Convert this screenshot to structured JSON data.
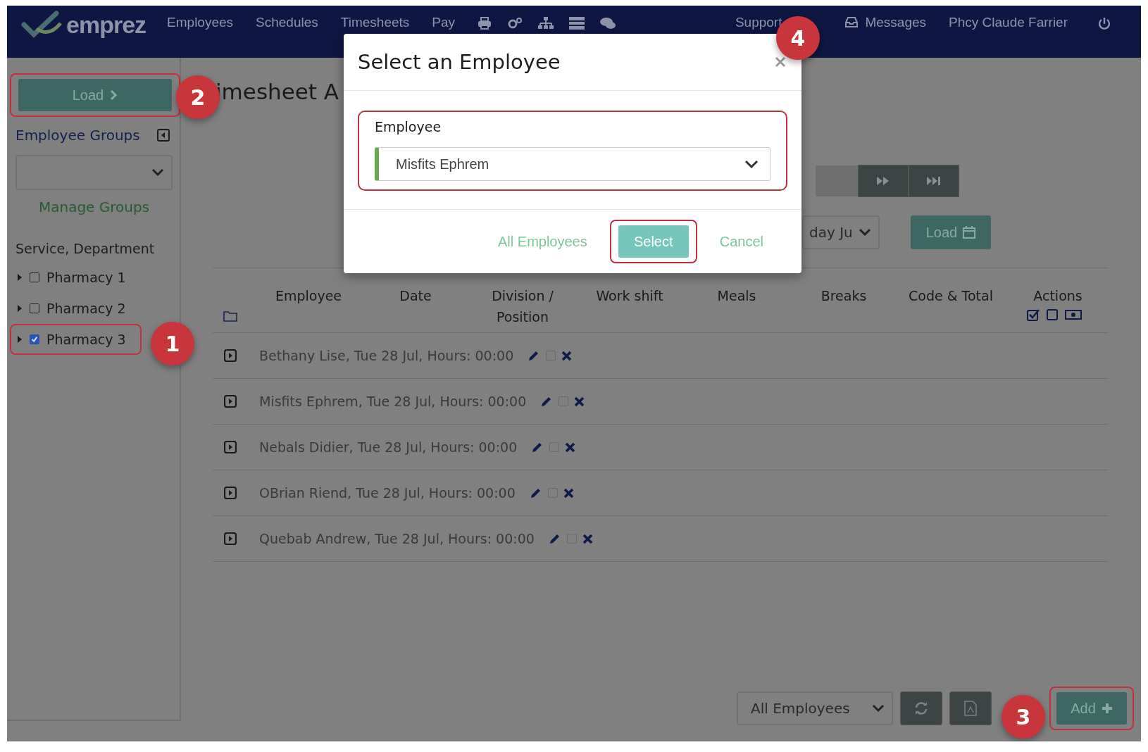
{
  "nav": {
    "logo": "emprez",
    "links": [
      "Employees",
      "Schedules",
      "Timesheets",
      "Pay"
    ],
    "support": "Support",
    "messages": "Messages",
    "user": "Phcy Claude Farrier"
  },
  "sidebar": {
    "load_button": "Load",
    "groups_label": "Employee Groups",
    "manage_groups": "Manage Groups",
    "tree_label": "Service, Department",
    "tree": [
      {
        "label": "Pharmacy 1",
        "checked": false,
        "highlighted": false
      },
      {
        "label": "Pharmacy 2",
        "checked": false,
        "highlighted": false
      },
      {
        "label": "Pharmacy 3",
        "checked": true,
        "highlighted": true
      }
    ]
  },
  "page_title": "imesheet A",
  "filters": {
    "period_select": "day Ju",
    "load_button": "Load"
  },
  "table": {
    "columns": [
      "Employee",
      "Date",
      "Division / Position",
      "Work shift",
      "Meals",
      "Breaks",
      "Code & Total",
      "Actions"
    ],
    "rows": [
      {
        "text": "Bethany Lise, Tue 28 Jul, Hours: 00:00",
        "checked": false
      },
      {
        "text": "Misfits Ephrem, Tue 28 Jul, Hours: 00:00",
        "checked": false
      },
      {
        "text": "Nebals Didier, Tue 28 Jul, Hours: 00:00",
        "checked": false
      },
      {
        "text": "OBrian Riend, Tue 28 Jul, Hours: 00:00",
        "checked": false
      },
      {
        "text": "Quebab Andrew, Tue 28 Jul, Hours: 00:00",
        "checked": false
      }
    ]
  },
  "footer": {
    "filter_select": "All Employees",
    "add_button": "Add"
  },
  "modal": {
    "title": "Select an Employee",
    "field_label": "Employee",
    "field_value": "Misfits Ephrem",
    "buttons": [
      {
        "label": "All Employees",
        "kind": "link",
        "highlighted": false
      },
      {
        "label": "Select",
        "kind": "primary",
        "highlighted": true
      },
      {
        "label": "Cancel",
        "kind": "link",
        "highlighted": false
      }
    ]
  },
  "callouts": [
    "1",
    "2",
    "3",
    "4"
  ]
}
